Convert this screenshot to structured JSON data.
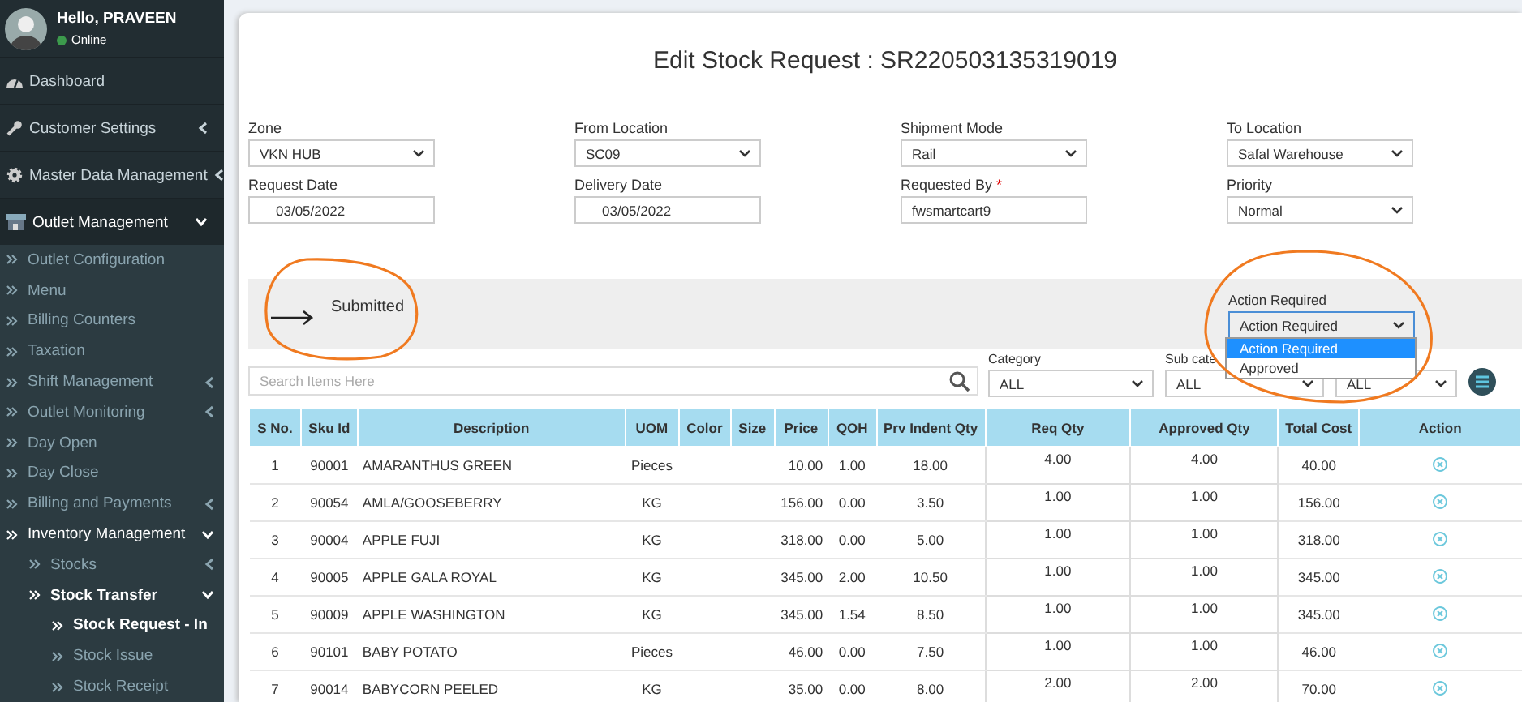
{
  "user": {
    "greeting": "Hello, PRAVEEN",
    "status": "Online"
  },
  "sidebar": {
    "items": [
      {
        "label": "Dashboard",
        "selected": false
      },
      {
        "label": "Customer Settings",
        "expanded": false,
        "selected": false
      },
      {
        "label": "Master Data Management",
        "expanded": false,
        "selected": false
      },
      {
        "label": "Outlet Management",
        "expanded": true,
        "selected": false,
        "children": [
          {
            "label": "Outlet Configuration",
            "selected": false
          },
          {
            "label": "Menu",
            "selected": false
          },
          {
            "label": "Billing Counters",
            "selected": false
          },
          {
            "label": "Taxation",
            "selected": false
          },
          {
            "label": "Shift Management",
            "expanded": false,
            "selected": false
          },
          {
            "label": "Outlet Monitoring",
            "expanded": false,
            "selected": false
          },
          {
            "label": "Day Open",
            "selected": false
          },
          {
            "label": "Day Close",
            "selected": false
          },
          {
            "label": "Billing and Payments",
            "expanded": false,
            "selected": false
          },
          {
            "label": "Inventory Management",
            "expanded": true,
            "selected": true,
            "children": [
              {
                "label": "Stocks",
                "expanded": false,
                "selected": false
              },
              {
                "label": "Stock Transfer",
                "expanded": true,
                "selected": true,
                "children": [
                  {
                    "label": "Stock Request - In",
                    "selected": true
                  },
                  {
                    "label": "Stock Issue",
                    "selected": false
                  },
                  {
                    "label": "Stock Receipt",
                    "selected": false
                  }
                ]
              }
            ]
          }
        ]
      }
    ]
  },
  "title": "Edit Stock Request : SR220503135319019",
  "form": {
    "fields": [
      {
        "label": "Zone",
        "kind": "select",
        "value": "VKN HUB"
      },
      {
        "label": "From Location",
        "kind": "select",
        "value": "SC09"
      },
      {
        "label": "Shipment Mode",
        "kind": "select",
        "value": "Rail"
      },
      {
        "label": "To Location",
        "kind": "select",
        "value": "Safal Warehouse"
      },
      {
        "label": "Request Date",
        "kind": "date",
        "value": "03/05/2022"
      },
      {
        "label": "Delivery Date",
        "kind": "date",
        "value": "03/05/2022"
      },
      {
        "label": "Requested By",
        "kind": "text",
        "value": "fwsmartcart9",
        "required_mark": "*"
      },
      {
        "label": "Priority",
        "kind": "select",
        "value": "Normal"
      }
    ]
  },
  "status": {
    "text": "Submitted",
    "action": {
      "label": "Action Required",
      "value": "Action Required",
      "options": [
        {
          "label": "Action Required",
          "selected": true
        },
        {
          "label": "Approved",
          "selected": false
        }
      ]
    }
  },
  "filters": {
    "search": {
      "placeholder": "Search Items Here"
    },
    "selects": [
      {
        "label": "Category",
        "value": "ALL"
      },
      {
        "label": "Sub cate",
        "value": "ALL"
      },
      {
        "value": "ALL"
      }
    ]
  },
  "table": {
    "columns": [
      "S No.",
      "Sku Id",
      "Description",
      "UOM",
      "Color",
      "Size",
      "Price",
      "QOH",
      "Prv Indent Qty",
      "Req Qty",
      "Approved Qty",
      "Total Cost",
      "Action"
    ],
    "rows": [
      [
        "1",
        "90001",
        "AMARANTHUS GREEN",
        "Pieces",
        "",
        "",
        "10.00",
        "1.00",
        "18.00",
        "4.00",
        "4.00",
        "40.00"
      ],
      [
        "2",
        "90054",
        "AMLA/GOOSEBERRY",
        "KG",
        "",
        "",
        "156.00",
        "0.00",
        "3.50",
        "1.00",
        "1.00",
        "156.00"
      ],
      [
        "3",
        "90004",
        "APPLE FUJI",
        "KG",
        "",
        "",
        "318.00",
        "0.00",
        "5.00",
        "1.00",
        "1.00",
        "318.00"
      ],
      [
        "4",
        "90005",
        "APPLE GALA ROYAL",
        "KG",
        "",
        "",
        "345.00",
        "2.00",
        "10.50",
        "1.00",
        "1.00",
        "345.00"
      ],
      [
        "5",
        "90009",
        "APPLE WASHINGTON",
        "KG",
        "",
        "",
        "345.00",
        "1.54",
        "8.50",
        "1.00",
        "1.00",
        "345.00"
      ],
      [
        "6",
        "90101",
        "BABY POTATO",
        "Pieces",
        "",
        "",
        "46.00",
        "0.00",
        "7.50",
        "1.00",
        "1.00",
        "46.00"
      ],
      [
        "7",
        "90014",
        "BABYCORN PEELED",
        "KG",
        "",
        "",
        "35.00",
        "0.00",
        "8.00",
        "2.00",
        "2.00",
        "70.00"
      ]
    ]
  }
}
